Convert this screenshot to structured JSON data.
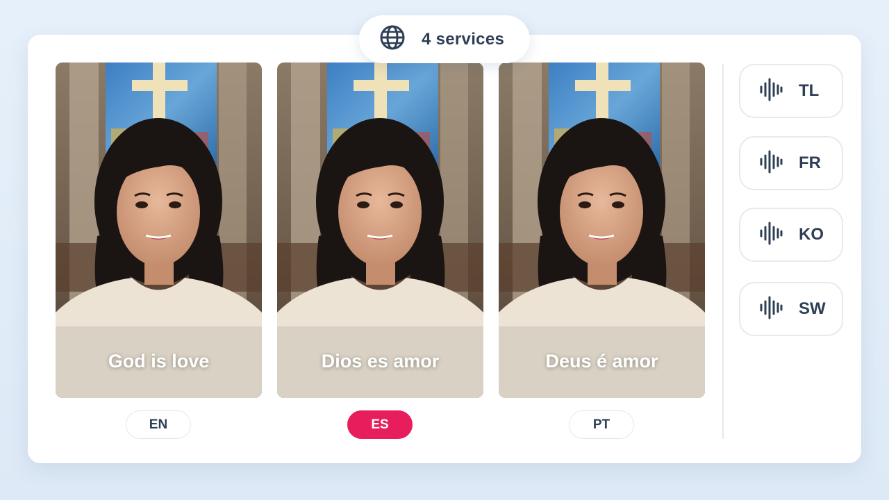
{
  "header": {
    "services_label": "4 services",
    "icon": "globe-icon"
  },
  "videos": [
    {
      "caption": "God is love",
      "lang": "EN",
      "active": false
    },
    {
      "caption": "Dios es amor",
      "lang": "ES",
      "active": true
    },
    {
      "caption": "Deus é amor",
      "lang": "PT",
      "active": false
    }
  ],
  "voices": [
    {
      "label": "TL",
      "icon": "audio-wave-icon"
    },
    {
      "label": "FR",
      "icon": "audio-wave-icon"
    },
    {
      "label": "KO",
      "icon": "audio-wave-icon"
    },
    {
      "label": "SW",
      "icon": "audio-wave-icon"
    }
  ],
  "colors": {
    "accent": "#e81d5c",
    "text": "#2e3f55",
    "background": "#e6f0fa"
  }
}
